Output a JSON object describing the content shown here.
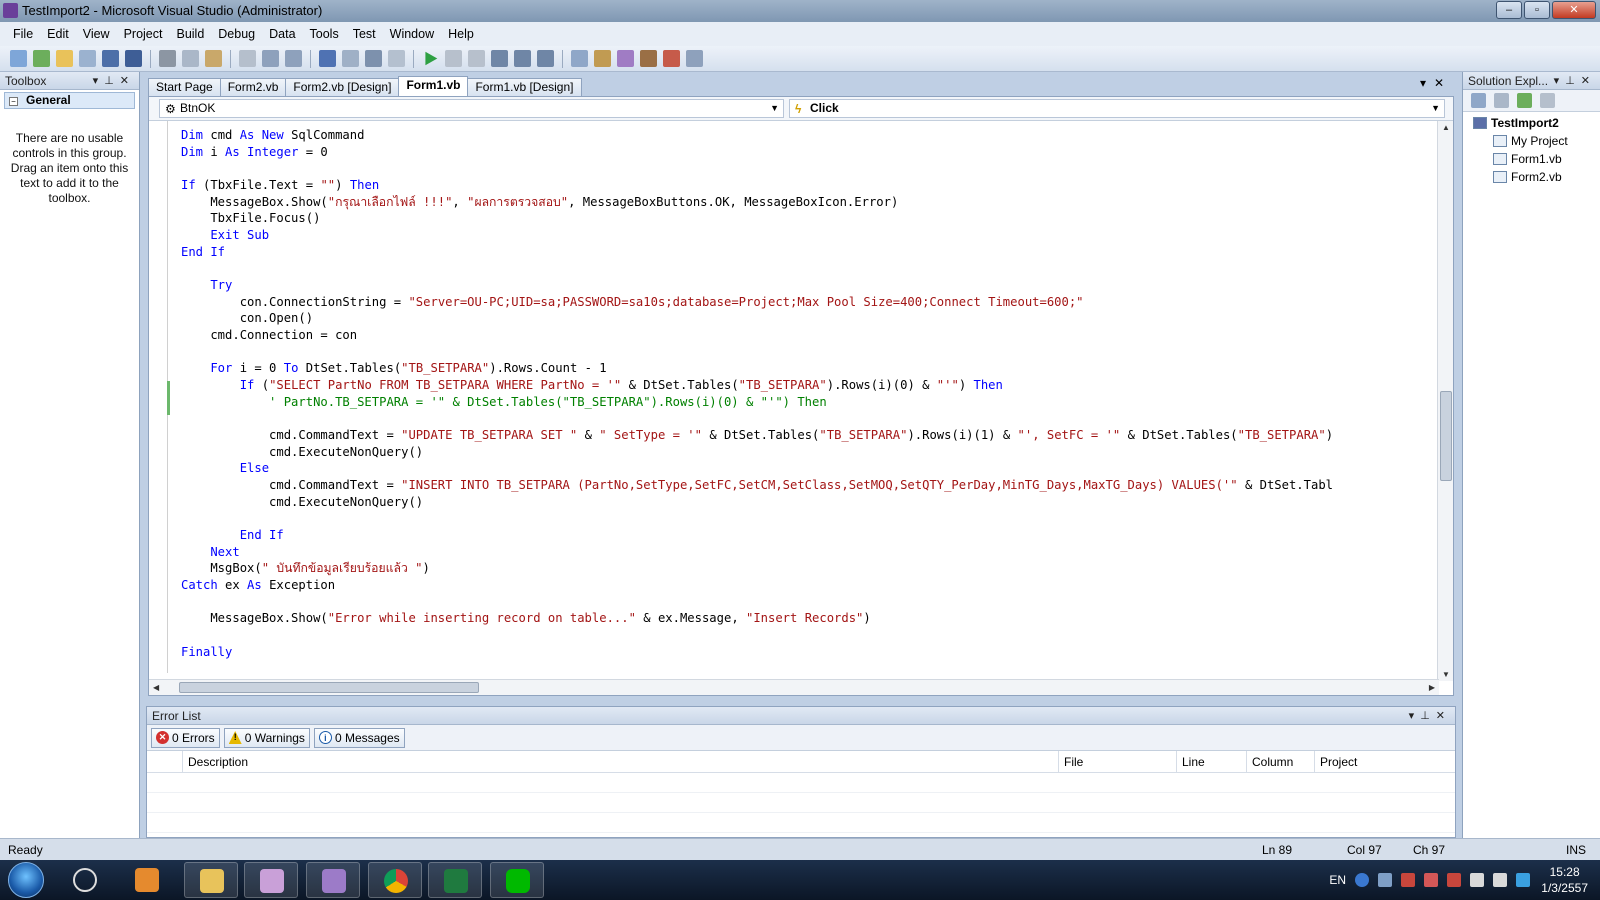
{
  "window": {
    "title": "TestImport2 - Microsoft Visual Studio (Administrator)"
  },
  "menu": [
    "File",
    "Edit",
    "View",
    "Project",
    "Build",
    "Debug",
    "Data",
    "Tools",
    "Test",
    "Window",
    "Help"
  ],
  "toolbox": {
    "title": "Toolbox",
    "group": "General",
    "message": "There are no usable controls in this group. Drag an item onto this text to add it to the toolbox."
  },
  "tabs": [
    "Start Page",
    "Form2.vb",
    "Form2.vb [Design]",
    "Form1.vb",
    "Form1.vb [Design]"
  ],
  "active_tab": "Form1.vb",
  "navbar": {
    "object": "BtnOK",
    "event": "Click"
  },
  "code_lines": [
    [
      [
        "kw",
        "Dim"
      ],
      [
        "tx",
        " cmd "
      ],
      [
        "kw",
        "As New"
      ],
      [
        "tx",
        " SqlCommand"
      ]
    ],
    [
      [
        "kw",
        "Dim"
      ],
      [
        "tx",
        " i "
      ],
      [
        "kw",
        "As Integer"
      ],
      [
        "tx",
        " = 0"
      ]
    ],
    [],
    [
      [
        "kw",
        "If"
      ],
      [
        "tx",
        " (TbxFile.Text = "
      ],
      [
        "str",
        "\"\""
      ],
      [
        "tx",
        ") "
      ],
      [
        "kw",
        "Then"
      ]
    ],
    [
      [
        "tx",
        "    MessageBox.Show("
      ],
      [
        "str",
        "\"กรุณาเลือกไฟล์ !!!\""
      ],
      [
        "tx",
        ", "
      ],
      [
        "str",
        "\"ผลการตรวจสอบ\""
      ],
      [
        "tx",
        ", MessageBoxButtons.OK, MessageBoxIcon.Error)"
      ]
    ],
    [
      [
        "tx",
        "    TbxFile.Focus()"
      ]
    ],
    [
      [
        "kw",
        "    Exit Sub"
      ]
    ],
    [
      [
        "kw",
        "End If"
      ]
    ],
    [],
    [
      [
        "kw",
        "    Try"
      ]
    ],
    [
      [
        "tx",
        "        con.ConnectionString = "
      ],
      [
        "str",
        "\"Server=OU-PC;UID=sa;PASSWORD=sa10s;database=Project;Max Pool Size=400;Connect Timeout=600;\""
      ]
    ],
    [
      [
        "tx",
        "        con.Open()"
      ]
    ],
    [
      [
        "tx",
        "    cmd.Connection = con"
      ]
    ],
    [],
    [
      [
        "kw",
        "    For"
      ],
      [
        "tx",
        " i = 0 "
      ],
      [
        "kw",
        "To"
      ],
      [
        "tx",
        " DtSet.Tables("
      ],
      [
        "str",
        "\"TB_SETPARA\""
      ],
      [
        "tx",
        ").Rows.Count - 1"
      ]
    ],
    [
      [
        "kw",
        "        If"
      ],
      [
        "tx",
        " ("
      ],
      [
        "str",
        "\"SELECT PartNo FROM TB_SETPARA WHERE PartNo = '\""
      ],
      [
        "tx",
        " & DtSet.Tables("
      ],
      [
        "str",
        "\"TB_SETPARA\""
      ],
      [
        "tx",
        ").Rows(i)(0) & "
      ],
      [
        "str",
        "\"'\""
      ],
      [
        "tx",
        ") "
      ],
      [
        "kw",
        "Then"
      ]
    ],
    [
      [
        "cm",
        "            ' PartNo.TB_SETPARA = '\" & DtSet.Tables(\"TB_SETPARA\").Rows(i)(0) & \"'\") Then"
      ]
    ],
    [],
    [
      [
        "tx",
        "            cmd.CommandText = "
      ],
      [
        "str",
        "\"UPDATE TB_SETPARA SET \""
      ],
      [
        "tx",
        " & "
      ],
      [
        "str",
        "\" SetType = '\""
      ],
      [
        "tx",
        " & DtSet.Tables("
      ],
      [
        "str",
        "\"TB_SETPARA\""
      ],
      [
        "tx",
        ").Rows(i)(1) & "
      ],
      [
        "str",
        "\"', SetFC = '\""
      ],
      [
        "tx",
        " & DtSet.Tables("
      ],
      [
        "str",
        "\"TB_SETPARA\""
      ],
      [
        "tx",
        ")"
      ]
    ],
    [
      [
        "tx",
        "            cmd.ExecuteNonQuery()"
      ]
    ],
    [
      [
        "kw",
        "        Else"
      ]
    ],
    [
      [
        "tx",
        "            cmd.CommandText = "
      ],
      [
        "str",
        "\"INSERT INTO TB_SETPARA (PartNo,SetType,SetFC,SetCM,SetClass,SetMOQ,SetQTY_PerDay,MinTG_Days,MaxTG_Days) VALUES('\""
      ],
      [
        "tx",
        " & DtSet.Tabl"
      ]
    ],
    [
      [
        "tx",
        "            cmd.ExecuteNonQuery()"
      ]
    ],
    [],
    [
      [
        "kw",
        "        End If"
      ]
    ],
    [
      [
        "kw",
        "    Next"
      ]
    ],
    [
      [
        "tx",
        "    MsgBox("
      ],
      [
        "str",
        "\" บันทึกข้อมูลเรียบร้อยแล้ว \""
      ],
      [
        "tx",
        ")"
      ]
    ],
    [
      [
        "kw",
        "Catch"
      ],
      [
        "tx",
        " ex "
      ],
      [
        "kw",
        "As"
      ],
      [
        "tx",
        " Exception"
      ]
    ],
    [],
    [
      [
        "tx",
        "    MessageBox.Show("
      ],
      [
        "str",
        "\"Error while inserting record on table...\""
      ],
      [
        "tx",
        " & ex.Message, "
      ],
      [
        "str",
        "\"Insert Records\""
      ],
      [
        "tx",
        ")"
      ]
    ],
    [],
    [
      [
        "kw",
        "Finally"
      ]
    ]
  ],
  "errorlist": {
    "title": "Error List",
    "errors": "0 Errors",
    "warnings": "0 Warnings",
    "messages": "0 Messages",
    "columns": [
      "Description",
      "File",
      "Line",
      "Column",
      "Project"
    ]
  },
  "solution": {
    "title": "Solution Expl...",
    "project": "TestImport2",
    "items": [
      "My Project",
      "Form1.vb",
      "Form2.vb"
    ]
  },
  "status": {
    "text": "Ready",
    "ln": "Ln 89",
    "col": "Col 97",
    "ch": "Ch 97",
    "mode": "INS"
  },
  "taskbar": {
    "lang": "EN",
    "time": "15:28",
    "date": "1/3/2557"
  },
  "colors": {
    "keyword": "#0000ff",
    "string": "#a31515",
    "comment": "#008000",
    "accent": "#1a5aa8"
  }
}
